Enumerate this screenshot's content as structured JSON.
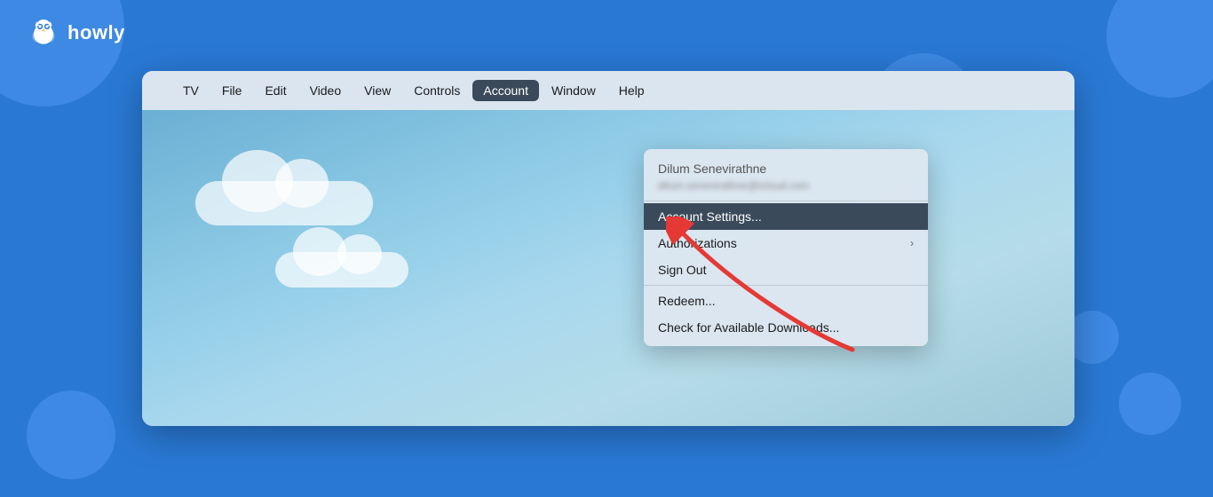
{
  "brand": {
    "name": "howly",
    "logo_alt": "Howly owl logo"
  },
  "background_circles": [
    1,
    2,
    3,
    4,
    5,
    6,
    7
  ],
  "menubar": {
    "items": [
      {
        "id": "apple",
        "label": "🍎",
        "is_apple": true
      },
      {
        "id": "tv",
        "label": "TV"
      },
      {
        "id": "file",
        "label": "File"
      },
      {
        "id": "edit",
        "label": "Edit"
      },
      {
        "id": "video",
        "label": "Video"
      },
      {
        "id": "view",
        "label": "View"
      },
      {
        "id": "controls",
        "label": "Controls"
      },
      {
        "id": "account",
        "label": "Account",
        "active": true
      },
      {
        "id": "window",
        "label": "Window"
      },
      {
        "id": "help",
        "label": "Help"
      }
    ]
  },
  "dropdown": {
    "user_name": "Dilum Senevirathne",
    "user_email": "dilum.senevirathne@example.com",
    "items": [
      {
        "id": "account-settings",
        "label": "Account Settings...",
        "highlighted": true
      },
      {
        "id": "authorizations",
        "label": "Authorizations",
        "has_submenu": true
      },
      {
        "id": "sign-out",
        "label": "Sign Out"
      },
      {
        "id": "redeem",
        "label": "Redeem..."
      },
      {
        "id": "check-downloads",
        "label": "Check for Available Downloads..."
      }
    ]
  },
  "arrow": {
    "color": "#e53935",
    "points_to": "Account Settings"
  }
}
